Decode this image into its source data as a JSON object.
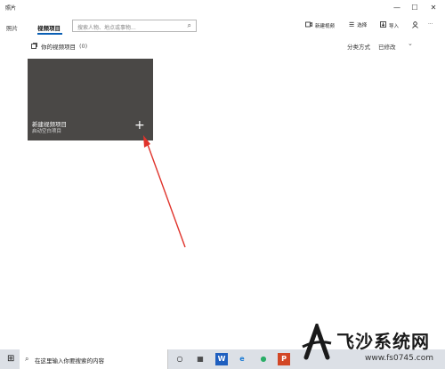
{
  "window": {
    "app_title": "照片",
    "minimize_glyph": "—",
    "maximize_glyph": "☐",
    "close_glyph": "✕"
  },
  "nav": {
    "photos_label": "照片",
    "video_projects_label": "视频项目",
    "search_placeholder": "搜索人物、地点或事物..."
  },
  "toolbar": {
    "new_video_label": "新建视频",
    "select_label": "选择",
    "import_label": "导入",
    "more_glyph": "···"
  },
  "section": {
    "title": "你的视频项目",
    "count": "(0)",
    "sort_label": "分类方式",
    "sort_value": "已修改"
  },
  "tile": {
    "title": "新建视频项目",
    "subtitle": "启动空白项目",
    "plus_glyph": "+"
  },
  "taskbar": {
    "search_placeholder": "在这里输入你要搜索的内容"
  },
  "watermark": {
    "site_name": "飞沙系统网",
    "url": "www.fs0745.com"
  },
  "colors": {
    "accent": "#0a5fb4",
    "tile_bg": "#4a4846",
    "arrow": "#e0332b",
    "taskbar_bg": "#dce0e6"
  }
}
